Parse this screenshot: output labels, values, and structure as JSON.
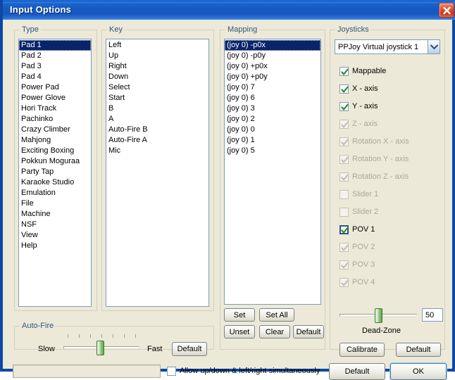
{
  "window": {
    "title": "Input Options",
    "close_icon": "close-x-icon",
    "accent_titlebar": "#1858c0",
    "face_color": "#ece9d8",
    "selection_color": "#0a246a",
    "group_label_color": "#33557f"
  },
  "type_group": {
    "label": "Type",
    "items": [
      "Pad 1",
      "Pad 2",
      "Pad 3",
      "Pad 4",
      "Power Pad",
      "Power Glove",
      "Hori Track",
      "Pachinko",
      "Crazy Climber",
      "Mahjong",
      "Exciting Boxing",
      "Pokkun Moguraa",
      "Party Tap",
      "Karaoke Studio",
      "Emulation",
      "File",
      "Machine",
      "NSF",
      "View",
      "Help"
    ],
    "selected_index": 0
  },
  "key_group": {
    "label": "Key",
    "items": [
      "Left",
      "Up",
      "Right",
      "Down",
      "Select",
      "Start",
      "B",
      "A",
      "Auto-Fire B",
      "Auto-Fire A",
      "Mic"
    ],
    "selected_index": -1
  },
  "mapping_group": {
    "label": "Mapping",
    "items": [
      "(joy 0) -p0x",
      "(joy 0) -p0y",
      "(joy 0) +p0x",
      "(joy 0) +p0y",
      "(joy 0) 7",
      "(joy 0) 6",
      "(joy 0) 3",
      "(joy 0) 2",
      "(joy 0) 0",
      "(joy 0) 1",
      "(joy 0) 5"
    ],
    "selected_index": 0,
    "buttons": {
      "set": "Set",
      "set_all": "Set All",
      "unset": "Unset",
      "clear": "Clear",
      "default": "Default"
    }
  },
  "joysticks_group": {
    "label": "Joysticks",
    "device_selected": "PPJoy Virtual joystick 1",
    "device_dropdown_icon": "chevron-down-icon",
    "checkboxes": [
      {
        "label": "Mappable",
        "checked": true,
        "enabled": true,
        "focused": false
      },
      {
        "label": "X - axis",
        "checked": true,
        "enabled": true,
        "focused": false
      },
      {
        "label": "Y - axis",
        "checked": true,
        "enabled": true,
        "focused": false
      },
      {
        "label": "Z - axis",
        "checked": true,
        "enabled": false,
        "focused": false
      },
      {
        "label": "Rotation X - axis",
        "checked": true,
        "enabled": false,
        "focused": false
      },
      {
        "label": "Rotation Y - axis",
        "checked": true,
        "enabled": false,
        "focused": false
      },
      {
        "label": "Rotation Z - axis",
        "checked": true,
        "enabled": false,
        "focused": false
      },
      {
        "label": "Slider 1",
        "checked": false,
        "enabled": false,
        "focused": false
      },
      {
        "label": "Slider 2",
        "checked": false,
        "enabled": false,
        "focused": false
      },
      {
        "label": "POV 1",
        "checked": true,
        "enabled": true,
        "focused": true
      },
      {
        "label": "POV 2",
        "checked": true,
        "enabled": false,
        "focused": false
      },
      {
        "label": "POV 3",
        "checked": true,
        "enabled": false,
        "focused": false
      },
      {
        "label": "POV 4",
        "checked": true,
        "enabled": false,
        "focused": false
      }
    ],
    "dead_zone": {
      "label": "Dead-Zone",
      "value": "50",
      "value_number": 50,
      "min": 0,
      "max": 100
    },
    "buttons": {
      "calibrate": "Calibrate",
      "default": "Default"
    }
  },
  "autofire_group": {
    "label": "Auto-Fire",
    "slow_label": "Slow",
    "fast_label": "Fast",
    "default_label": "Default",
    "slider_percent": 48,
    "tick_count": 7
  },
  "bottom_bar": {
    "input_value": "",
    "input_placeholder": "",
    "allow_simultaneous": {
      "label": "Allow up/down & left/right simultaneously",
      "checked": false
    },
    "default_label": "Default",
    "ok_label": "OK"
  }
}
